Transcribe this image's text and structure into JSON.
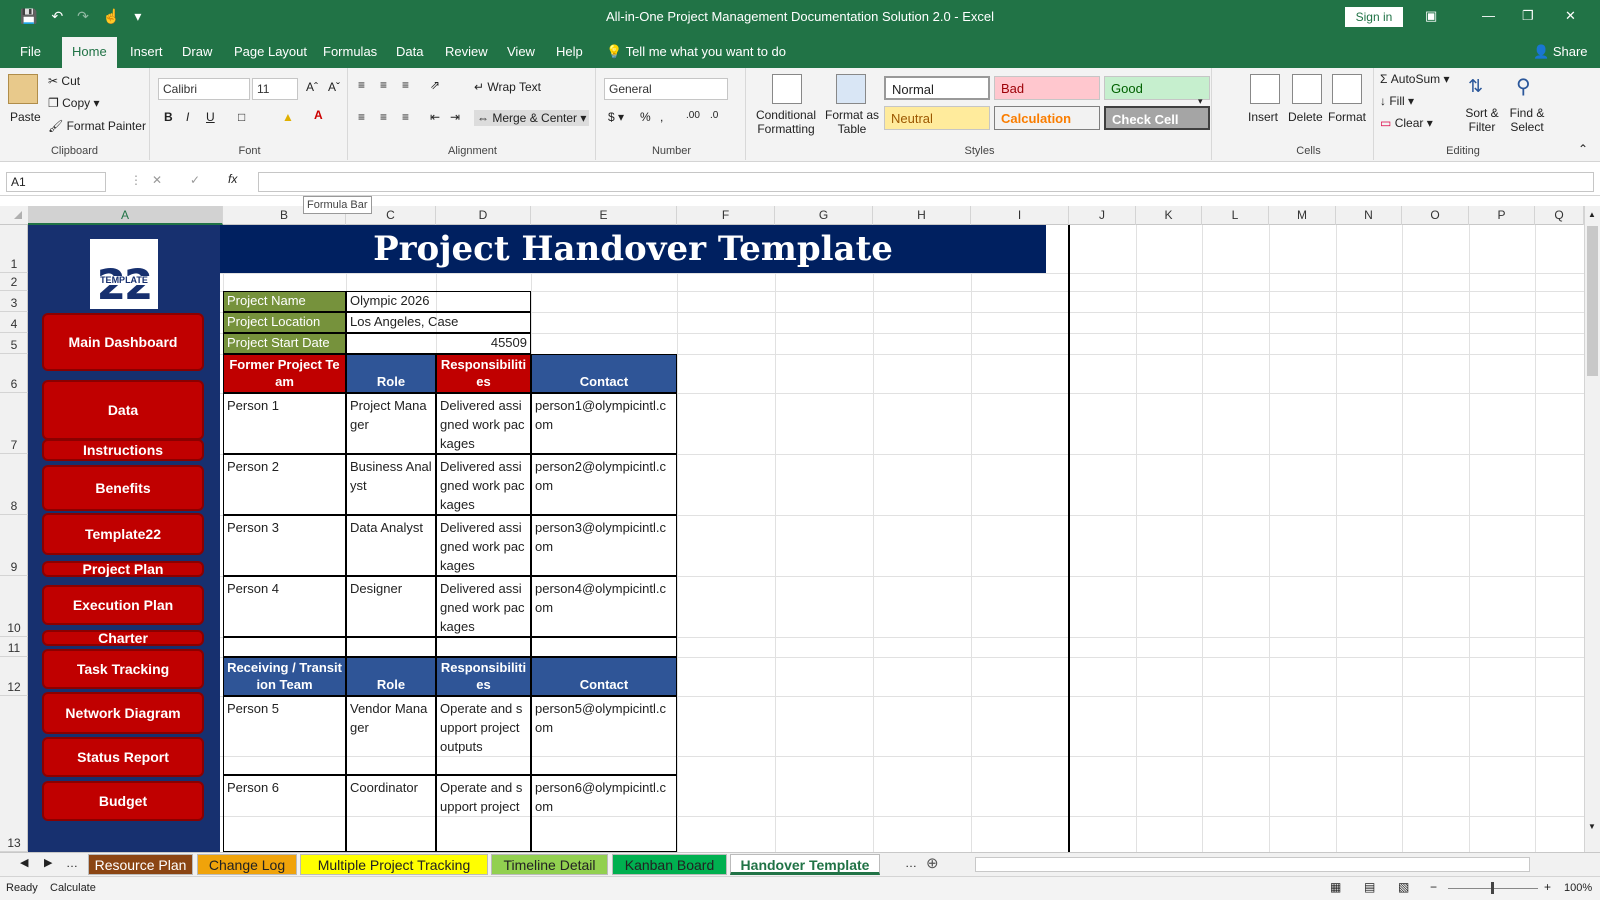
{
  "window": {
    "title": "All-in-One Project Management Documentation Solution 2.0  -  Excel",
    "sign_in": "Sign in",
    "share": "Share"
  },
  "menu": {
    "tabs": [
      "File",
      "Home",
      "Insert",
      "Draw",
      "Page Layout",
      "Formulas",
      "Data",
      "Review",
      "View",
      "Help"
    ],
    "tell_me": "Tell me what you want to do"
  },
  "ribbon": {
    "clipboard": {
      "paste": "Paste",
      "cut": "Cut",
      "copy": "Copy",
      "format_painter": "Format Painter",
      "label": "Clipboard"
    },
    "font": {
      "name": "Calibri",
      "size": "11",
      "label": "Font"
    },
    "alignment": {
      "wrap": "Wrap Text",
      "merge": "Merge & Center",
      "label": "Alignment"
    },
    "number": {
      "format": "General",
      "label": "Number"
    },
    "styles": {
      "conditional": "Conditional Formatting",
      "format_table": "Format as Table",
      "normal": "Normal",
      "bad": "Bad",
      "good": "Good",
      "neutral": "Neutral",
      "calculation": "Calculation",
      "check_cell": "Check Cell",
      "label": "Styles"
    },
    "cells": {
      "insert": "Insert",
      "delete": "Delete",
      "format": "Format",
      "label": "Cells"
    },
    "editing": {
      "autosum": "AutoSum",
      "fill": "Fill",
      "clear": "Clear",
      "sort": "Sort & Filter",
      "find": "Find & Select",
      "label": "Editing"
    }
  },
  "formula_bar": {
    "name_box": "A1",
    "fx": "fx",
    "tooltip": "Formula Bar"
  },
  "columns": [
    "A",
    "B",
    "C",
    "D",
    "E",
    "F",
    "G",
    "H",
    "I",
    "J",
    "K",
    "L",
    "M",
    "N",
    "O",
    "P",
    "Q"
  ],
  "rows": [
    "1",
    "2",
    "3",
    "4",
    "5",
    "6",
    "7",
    "8",
    "9",
    "10",
    "11",
    "12",
    "13"
  ],
  "sidebar": {
    "logo_top": "22",
    "logo_text": "TEMPLATE",
    "items": [
      "Main Dashboard",
      "Data",
      "Instructions",
      "Benefits",
      "Template22",
      "Project Plan",
      "Execution Plan",
      "Charter",
      "Task Tracking",
      "Network Diagram",
      "Status Report",
      "Budget"
    ]
  },
  "sheet": {
    "title": "Project Handover Template",
    "info": [
      {
        "label": "Project Name",
        "value": "Olympic 2026"
      },
      {
        "label": "Project Location",
        "value": "Los Angeles, Case"
      },
      {
        "label": "Project Start Date",
        "value": "45509"
      }
    ],
    "former_headers": [
      "Former Project Team",
      "Role",
      "Responsibilities",
      "Contact"
    ],
    "former": [
      {
        "person": "Person 1",
        "role": "Project Manager",
        "resp": "Delivered assigned work packages",
        "contact": "person1@olympicintl.com"
      },
      {
        "person": "Person 2",
        "role": "Business Analyst",
        "resp": "Delivered assigned work packages",
        "contact": "person2@olympicintl.com"
      },
      {
        "person": "Person 3",
        "role": "Data Analyst",
        "resp": "Delivered assigned work packages",
        "contact": "person3@olympicintl.com"
      },
      {
        "person": "Person 4",
        "role": "Designer",
        "resp": "Delivered assigned work packages",
        "contact": "person4@olympicintl.com"
      }
    ],
    "receiving_headers": [
      "Receiving / Transition Team",
      "Role",
      "Responsibilities",
      "Contact"
    ],
    "receiving": [
      {
        "person": "Person 5",
        "role": "Vendor Manager",
        "resp": "Operate and support project outputs",
        "contact": "person5@olympicintl.com"
      },
      {
        "person": "Person 6",
        "role": "Coordinator",
        "resp": "Operate and support project",
        "contact": "person6@olympicintl.com"
      }
    ]
  },
  "sheet_tabs": [
    {
      "label": "Resource Plan",
      "color": "#8b4513",
      "text": "#ffffff"
    },
    {
      "label": "Change Log",
      "color": "#f0a30a",
      "text": "#222222"
    },
    {
      "label": "Multiple Project  Tracking",
      "color": "#ffff00",
      "text": "#222222"
    },
    {
      "label": "Timeline Detail",
      "color": "#92d050",
      "text": "#222222"
    },
    {
      "label": "Kanban Board",
      "color": "#00b050",
      "text": "#222222"
    },
    {
      "label": "Handover Template",
      "color": "#ffffff",
      "text": "#217346"
    }
  ],
  "status": {
    "ready": "Ready",
    "calculate": "Calculate",
    "zoom": "100%"
  },
  "colors": {
    "excel_green": "#217346",
    "nav_red": "#c00000",
    "nav_bg": "#17306f",
    "title_navy": "#002060",
    "header_blue": "#2f5597",
    "label_green": "#76923c"
  }
}
